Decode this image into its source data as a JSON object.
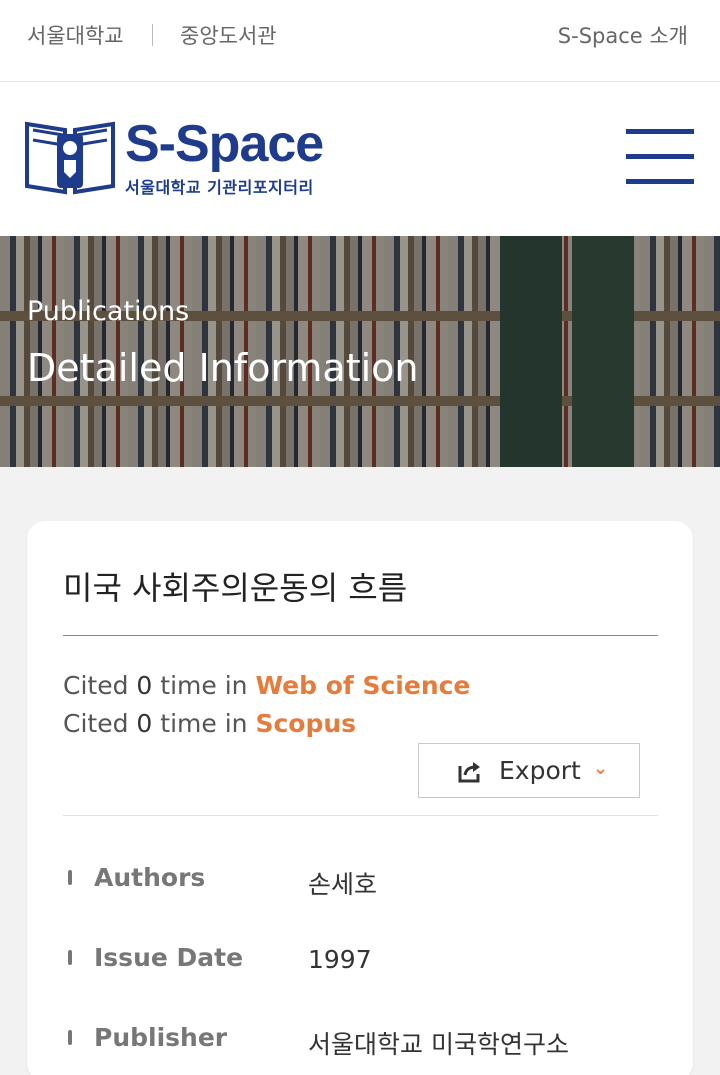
{
  "topbar": {
    "link_snu": "서울대학교",
    "link_library": "중앙도서관",
    "link_about": "S-Space 소개"
  },
  "header": {
    "logo_main": "S-Space",
    "logo_sub": "서울대학교 기관리포지터리",
    "menu_icon": "hamburger-menu-icon"
  },
  "hero": {
    "subtitle": "Publications",
    "title": "Detailed Information"
  },
  "item": {
    "title": "미국 사회주의운동의 흐름",
    "citations": [
      {
        "prefix": "Cited",
        "count": "0",
        "middle": "time in",
        "source": "Web of Science"
      },
      {
        "prefix": "Cited",
        "count": "0",
        "middle": "time in",
        "source": "Scopus"
      }
    ],
    "export_label": "Export",
    "metadata": [
      {
        "label": "Authors",
        "value": "손세호"
      },
      {
        "label": "Issue Date",
        "value": "1997"
      },
      {
        "label": "Publisher",
        "value": "서울대학교 미국학연구소"
      }
    ]
  },
  "colors": {
    "brand": "#1f3c8c",
    "accent": "#e57c3b"
  }
}
